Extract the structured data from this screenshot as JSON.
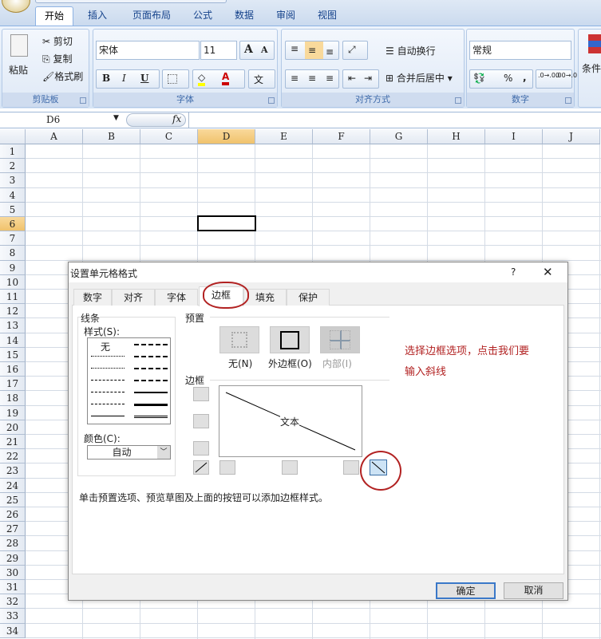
{
  "ribbon": {
    "tabs": [
      "开始",
      "插入",
      "页面布局",
      "公式",
      "数据",
      "审阅",
      "视图"
    ],
    "clipboard": {
      "paste": "粘贴",
      "cut": "剪切",
      "copy": "复制",
      "format_painter": "格式刷",
      "label": "剪贴板"
    },
    "font": {
      "name": "宋体",
      "size": "11",
      "bold": "B",
      "italic": "I",
      "underline": "U",
      "label": "字体"
    },
    "alignment": {
      "wrap": "自动换行",
      "merge": "合并后居中",
      "label": "对齐方式"
    },
    "number": {
      "format": "常规",
      "percent": "%",
      "comma": ",",
      "inc_decimal": ".0→.00",
      "dec_decimal": ".00→.0",
      "label": "数字"
    },
    "styles": {
      "conditional": "条件"
    }
  },
  "formula_bar": {
    "name_box": "D6",
    "fx": "fx",
    "value": ""
  },
  "grid": {
    "columns": [
      "A",
      "B",
      "C",
      "D",
      "E",
      "F",
      "G",
      "H",
      "I",
      "J"
    ],
    "rows": [
      "1",
      "2",
      "3",
      "4",
      "5",
      "6",
      "7",
      "8",
      "9",
      "10",
      "11",
      "12",
      "13",
      "14",
      "15",
      "16",
      "17",
      "18",
      "19",
      "20",
      "21",
      "22",
      "23",
      "24",
      "25",
      "26",
      "27",
      "28",
      "29",
      "30",
      "31",
      "32",
      "33",
      "34"
    ],
    "active_cell": "D6"
  },
  "dialog": {
    "title": "设置单元格格式",
    "help": "?",
    "close": "✕",
    "tabs": [
      "数字",
      "对齐",
      "字体",
      "边框",
      "填充",
      "保护"
    ],
    "active_tab": "边框",
    "line": {
      "label": "线条",
      "style_label": "样式(S):",
      "none": "无",
      "color_label": "颜色(C):",
      "color_value": "自动"
    },
    "presets": {
      "label": "预置",
      "none": "无(N)",
      "outline": "外边框(O)",
      "inside": "内部(I)"
    },
    "border": {
      "label": "边框",
      "preview_text": "文本"
    },
    "hint": "单击预置选项、预览草图及上面的按钮可以添加边框样式。",
    "ok": "确定",
    "cancel": "取消"
  },
  "annotation": {
    "line1": "选择边框选项，点击我们要",
    "line2": "输入斜线",
    "color": "#b22222"
  }
}
